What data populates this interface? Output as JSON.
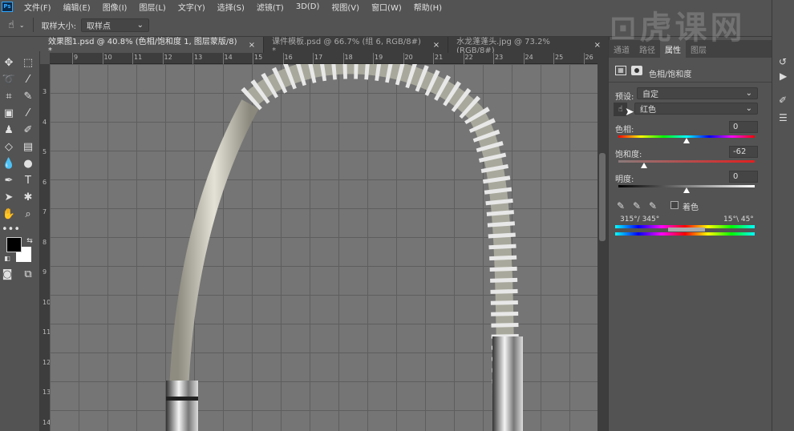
{
  "app": {
    "logo": "Ps"
  },
  "menu": [
    "文件(F)",
    "编辑(E)",
    "图像(I)",
    "图层(L)",
    "文字(Y)",
    "选择(S)",
    "滤镜(T)",
    "3D(D)",
    "视图(V)",
    "窗口(W)",
    "帮助(H)"
  ],
  "options": {
    "sample_size_label": "取样大小:",
    "sample_size_value": "取样点"
  },
  "doc_tabs": [
    {
      "label": "效果图1.psd @ 40.8% (色相/饱和度 1, 图层蒙版/8) *",
      "close": "×"
    },
    {
      "label": "课件模板.psd @ 66.7% (组 6, RGB/8#) *",
      "close": "×"
    },
    {
      "label": "水龙蓬蓬头.jpg @ 73.2%(RGB/8#)",
      "close": "×"
    }
  ],
  "rulers": {
    "horizontal": [
      "9",
      "10",
      "11",
      "12",
      "13",
      "14",
      "15",
      "16",
      "17",
      "18",
      "19",
      "20",
      "21",
      "22",
      "23",
      "24",
      "25",
      "26"
    ],
    "vertical": [
      "3",
      "4",
      "5",
      "6",
      "7",
      "8",
      "9",
      "10",
      "11",
      "12",
      "13",
      "14"
    ]
  },
  "panel": {
    "tabs": [
      "通道",
      "路径",
      "属性",
      "图层"
    ],
    "title": "色相/饱和度",
    "preset_label": "预设:",
    "preset_value": "自定",
    "channel_value": "红色",
    "hue_label": "色相:",
    "hue_value": "0",
    "hue_fraction": 0.5,
    "sat_label": "饱和度:",
    "sat_value": "-62",
    "sat_fraction": 0.19,
    "light_label": "明度:",
    "light_value": "0",
    "light_fraction": 0.5,
    "colorize_label": "着色",
    "range_left": "315°/ 345°",
    "range_right": "15°\\ 45°"
  },
  "watermark": "虎课网"
}
